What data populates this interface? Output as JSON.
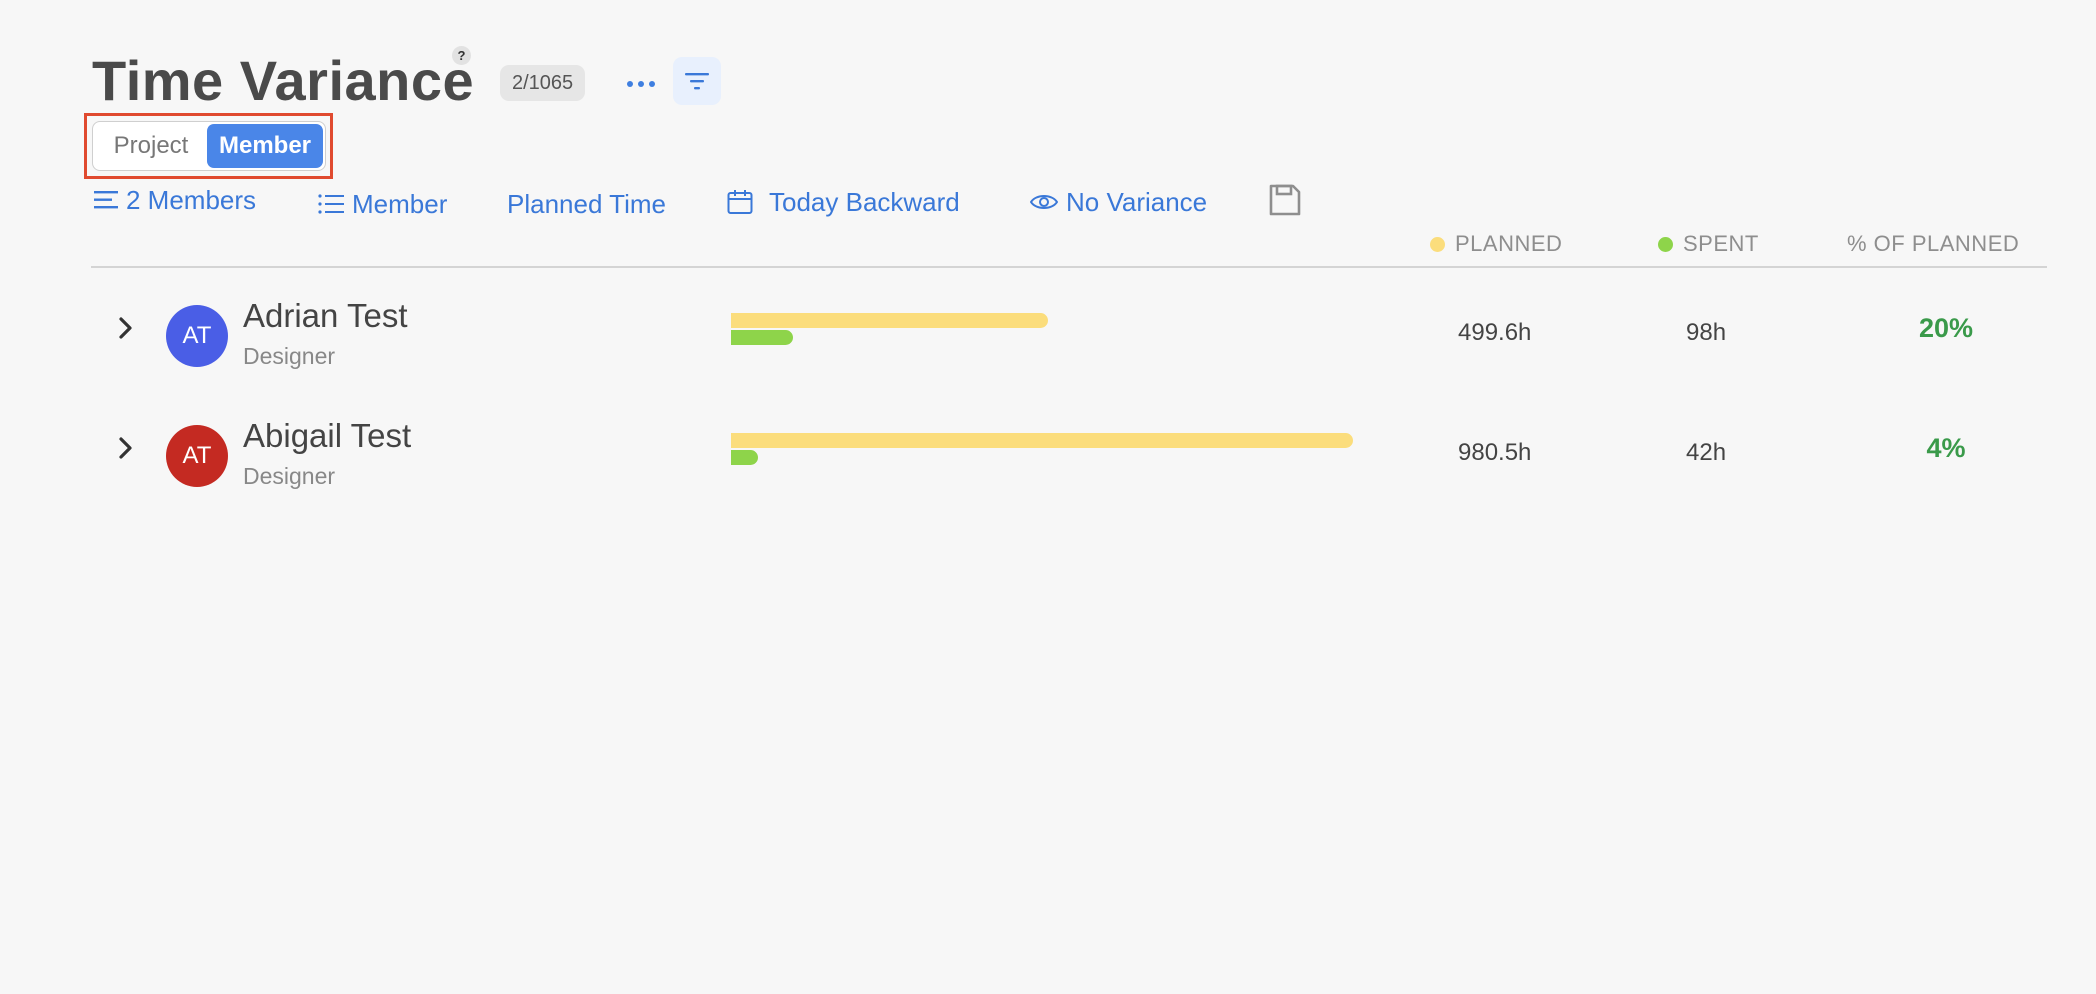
{
  "header": {
    "title": "Time Variance",
    "help_label": "?",
    "count_badge": "2/1065"
  },
  "toggle": {
    "options": [
      "Project",
      "Member"
    ],
    "selected": "Member"
  },
  "filters": {
    "members_count": "2 Members",
    "group_by": "Member",
    "metric": "Planned Time",
    "date_range": "Today Backward",
    "variance": "No Variance"
  },
  "columns": {
    "planned": "PLANNED",
    "spent": "SPENT",
    "percent": "% OF PLANNED"
  },
  "colors": {
    "accent": "#3a78d8",
    "planned": "#fbdd7c",
    "spent": "#8ed44a",
    "percent_text": "#3a9a4a"
  },
  "rows": [
    {
      "initials": "AT",
      "name": "Adrian Test",
      "role": "Designer",
      "planned": "499.6h",
      "spent": "98h",
      "percent": "20%",
      "avatar_color": "#4a5ee6",
      "planned_hours": 499.6,
      "spent_hours": 98
    },
    {
      "initials": "AT",
      "name": "Abigail Test",
      "role": "Designer",
      "planned": "980.5h",
      "spent": "42h",
      "percent": "4%",
      "avatar_color": "#c42a22",
      "planned_hours": 980.5,
      "spent_hours": 42
    }
  ]
}
